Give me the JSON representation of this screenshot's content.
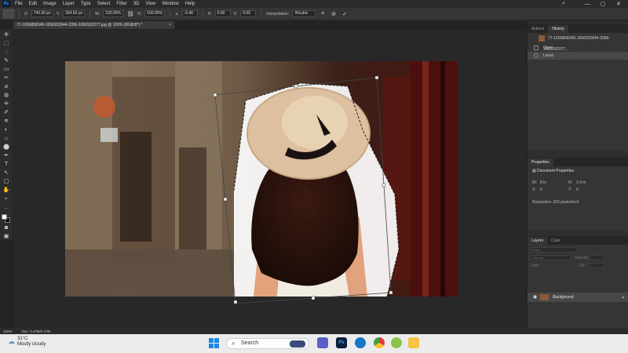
{
  "app": {
    "logo_text": "Ps",
    "menu": [
      "File",
      "Edit",
      "Image",
      "Layer",
      "Type",
      "Select",
      "Filter",
      "3D",
      "View",
      "Window",
      "Help"
    ],
    "window_controls": {
      "search": "⌕",
      "minimize": "—",
      "maximize": "▢",
      "close": "✕"
    }
  },
  "options_bar": {
    "x_label": "X:",
    "x_value": "740.00 px",
    "y_label": "Y:",
    "y_value": "394.50 px",
    "w_label": "W:",
    "w_value": "100.00%",
    "h_label": "H:",
    "h_value": "100.00%",
    "angle_label": "∠",
    "angle_value": "-6.46",
    "hskew_label": "H:",
    "hskew_value": "0.00",
    "vskew_label": "V:",
    "vskew_value": "0.00",
    "interp_label": "Interpolation:",
    "interp_value": "Bicubic",
    "cancel_icon": "⊘",
    "commit_icon": "✓"
  },
  "document_tab": {
    "title": "77-1656858349-1656922844-3356-1656932377.jpg @ 100% (RGB/8*) *",
    "close": "×"
  },
  "tools": [
    "✣",
    "⬚",
    "◌",
    "✎",
    "▭",
    "✂",
    "⌀",
    "◍",
    "✛",
    "✐",
    "≋",
    "◐",
    "⌂",
    "⬤",
    "✒",
    "T",
    "↖",
    "▢",
    "✋",
    "⌕",
    "…"
  ],
  "panels": {
    "history_tabs": [
      "Actions",
      "History"
    ],
    "history_doc": "77-1656858349-1656922844-3356-1656932377...",
    "history_items": [
      "Open",
      "Lasso"
    ],
    "properties_tab": "Properties",
    "properties_title": "Document Properties",
    "w_label": "W:",
    "w_value": "8 in",
    "h_label": "H:",
    "h_value": "2.4 in",
    "x_label": "X:",
    "x_value": "0",
    "y_label": "Y:",
    "y_value": "0",
    "resolution": "Resolution: 300 pixels/inch",
    "layers_tabs": [
      "Layers",
      "Color"
    ],
    "kind_placeholder": "Kind",
    "mode": "Normal",
    "opacity_label": "Opacity:",
    "fill_label": "Fill:",
    "lock_label": "Lock:",
    "layer_name": "Background"
  },
  "status": {
    "zoom": "100%",
    "doc": "Doc: 2.47M/2.47M"
  },
  "taskbar": {
    "temp": "31°C",
    "condition": "Mostly cloudy",
    "search": "Search"
  },
  "colors": {
    "accent": "#31a8ff",
    "taskbar": "#ececec"
  }
}
